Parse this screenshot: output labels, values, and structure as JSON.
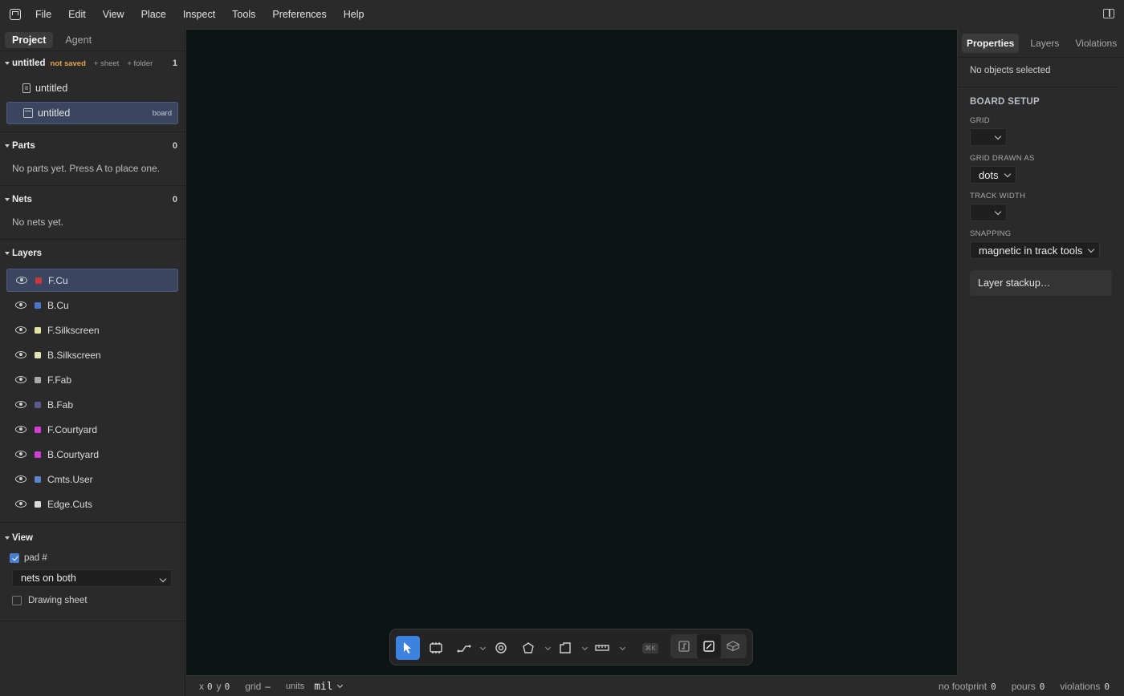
{
  "menu": {
    "items": [
      "File",
      "Edit",
      "View",
      "Place",
      "Inspect",
      "Tools",
      "Preferences",
      "Help"
    ]
  },
  "left_tabs": {
    "project": "Project",
    "agent": "Agent"
  },
  "project": {
    "name": "untitled",
    "status": "not saved",
    "add_sheet": "+ sheet",
    "add_folder": "+ folder",
    "count": "1",
    "files": [
      {
        "name": "untitled",
        "kind": "sheet",
        "tag": ""
      },
      {
        "name": "untitled",
        "kind": "board",
        "tag": "board"
      }
    ]
  },
  "parts": {
    "title": "Parts",
    "count": "0",
    "empty": "No parts yet. Press A to place one."
  },
  "nets": {
    "title": "Nets",
    "count": "0",
    "empty": "No nets yet."
  },
  "layers": {
    "title": "Layers",
    "items": [
      {
        "name": "F.Cu",
        "color": "#c83a3a"
      },
      {
        "name": "B.Cu",
        "color": "#4d74c6"
      },
      {
        "name": "F.Silkscreen",
        "color": "#e6e3a0"
      },
      {
        "name": "B.Silkscreen",
        "color": "#e4e3b4"
      },
      {
        "name": "F.Fab",
        "color": "#a8a8a8"
      },
      {
        "name": "B.Fab",
        "color": "#5a5a8e"
      },
      {
        "name": "F.Courtyard",
        "color": "#d63fcf"
      },
      {
        "name": "B.Courtyard",
        "color": "#cf3fd4"
      },
      {
        "name": "Cmts.User",
        "color": "#5a86d0"
      },
      {
        "name": "Edge.Cuts",
        "color": "#dadada"
      }
    ]
  },
  "view": {
    "title": "View",
    "pad_label": "pad #",
    "pad_checked": true,
    "nets_option": "nets on both",
    "drawing_sheet": "Drawing sheet",
    "drawing_sheet_checked": false
  },
  "toolbar": {
    "tools": [
      "select-tool",
      "footprint-tool",
      "route-tool",
      "via-tool",
      "zone-tool",
      "board-outline-tool",
      "measure-tool",
      "command-palette",
      "schematic-view",
      "board-view",
      "3d-view"
    ],
    "shortcut_badge": "⌘K"
  },
  "status": {
    "x_label": "x",
    "x_value": "0",
    "y_label": "y",
    "y_value": "0",
    "grid_label": "grid",
    "grid_value": "–",
    "units_label": "units",
    "units_value": "mil",
    "no_footprint_label": "no footprint",
    "no_footprint_value": "0",
    "pours_label": "pours",
    "pours_value": "0",
    "violations_label": "violations",
    "violations_value": "0"
  },
  "right_panel": {
    "tabs": [
      "Properties",
      "Layers",
      "Violations"
    ],
    "no_selection": "No objects selected",
    "board_setup_title": "BOARD SETUP",
    "grid_label": "GRID",
    "grid_value": "",
    "grid_drawn_label": "GRID DRAWN AS",
    "grid_drawn_value": "dots",
    "track_width_label": "TRACK WIDTH",
    "track_width_value": "",
    "snapping_label": "SNAPPING",
    "snapping_value": "magnetic in track tools",
    "stackup_button": "Layer stackup…"
  }
}
